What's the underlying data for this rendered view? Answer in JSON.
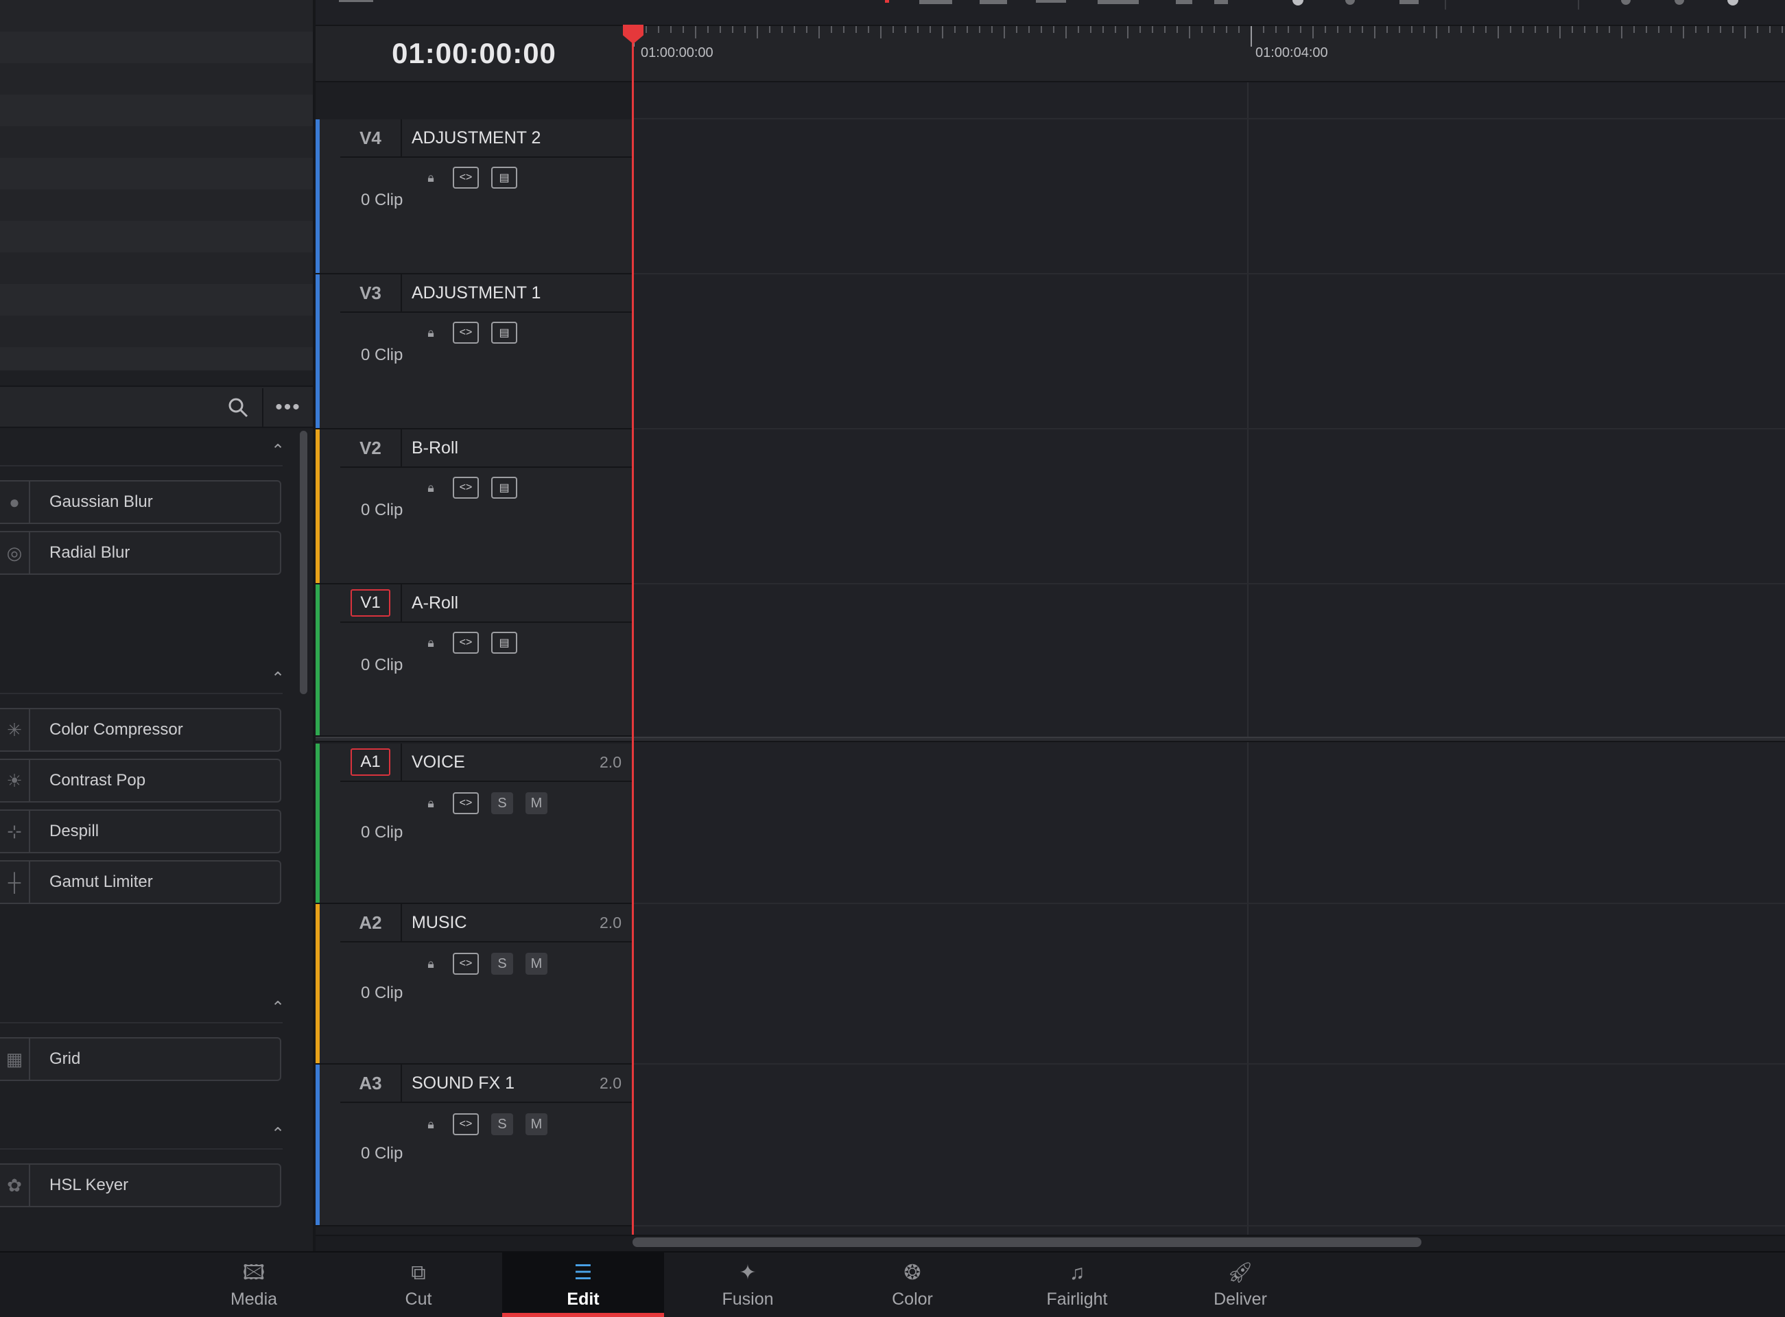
{
  "timeline": {
    "timecode": "01:00:00:00",
    "ruler_labels": [
      "01:00:00:00",
      "01:00:04:00"
    ]
  },
  "effects_panel": {
    "items": {
      "gaussian_blur": "Gaussian Blur",
      "radial_blur": "Radial Blur",
      "color_compressor": "Color Compressor",
      "contrast_pop": "Contrast Pop",
      "despill": "Despill",
      "gamut_limiter": "Gamut Limiter",
      "grid": "Grid",
      "hsl_keyer": "HSL Keyer"
    },
    "more_glyph": "•••"
  },
  "tracks": {
    "v4": {
      "id": "V4",
      "name": "ADJUSTMENT 2",
      "clips": "0 Clip",
      "color": "#3a7bd5"
    },
    "v3": {
      "id": "V3",
      "name": "ADJUSTMENT 1",
      "clips": "0 Clip",
      "color": "#3a7bd5"
    },
    "v2": {
      "id": "V2",
      "name": "B-Roll",
      "clips": "0 Clip",
      "color": "#e8a21a"
    },
    "v1": {
      "id": "V1",
      "name": "A-Roll",
      "clips": "0 Clip",
      "color": "#2fa84f"
    },
    "a1": {
      "id": "A1",
      "name": "VOICE",
      "channels": "2.0",
      "clips": "0 Clip",
      "color": "#2fa84f"
    },
    "a2": {
      "id": "A2",
      "name": "MUSIC",
      "channels": "2.0",
      "clips": "0 Clip",
      "color": "#e8a21a"
    },
    "a3": {
      "id": "A3",
      "name": "SOUND FX 1",
      "channels": "2.0",
      "clips": "0 Clip",
      "color": "#3a7bd5"
    }
  },
  "track_controls": {
    "solo": "S",
    "mute": "M"
  },
  "page_nav": {
    "media": "Media",
    "cut": "Cut",
    "edit": "Edit",
    "fusion": "Fusion",
    "color": "Color",
    "fairlight": "Fairlight",
    "deliver": "Deliver",
    "active": "Edit"
  },
  "colors": {
    "playhead": "#e5383b",
    "active_track_outline": "#d9333d",
    "edit_icon": "#4aa3e8"
  }
}
